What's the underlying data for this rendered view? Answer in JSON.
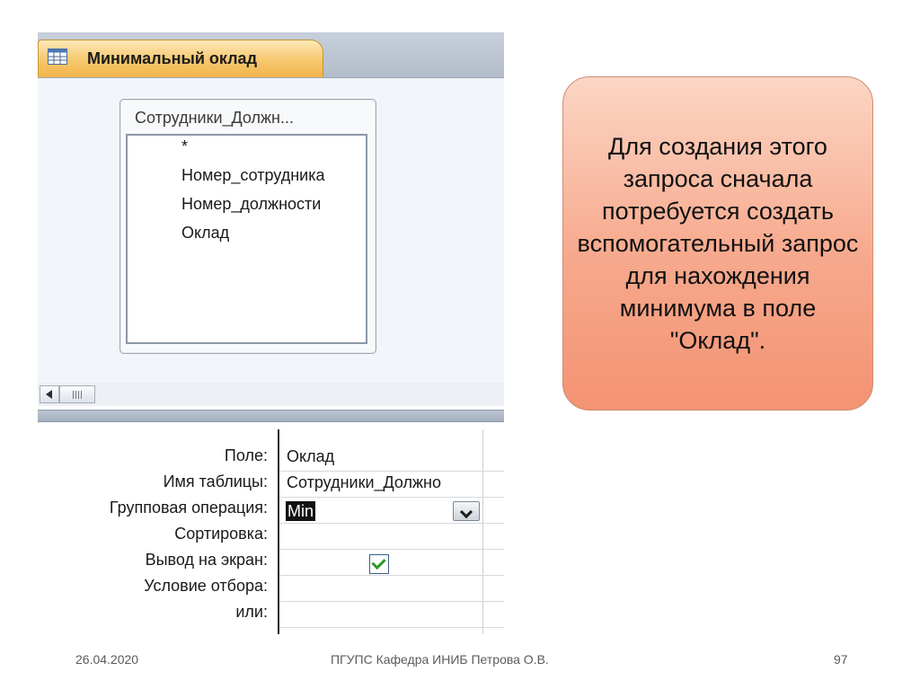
{
  "tab": {
    "title": "Минимальный оклад",
    "icon": "query-table-icon"
  },
  "field_list": {
    "title": "Сотрудники_Должн...",
    "fields": [
      "*",
      "Номер_сотрудника",
      "Номер_должности",
      "Оклад"
    ]
  },
  "grid": {
    "row_labels": [
      "Поле:",
      "Имя таблицы:",
      "Групповая операция:",
      "Сортировка:",
      "Вывод на экран:",
      "Условие отбора:",
      "или:"
    ],
    "field_value": "Оклад",
    "table_value": "Сотрудники_Должно",
    "group_operation": "Min",
    "show_checked": true
  },
  "callout": {
    "text": "Для создания этого запроса сначала потребуется создать вспомогательный запрос для нахождения минимума в поле \"Оклад\"."
  },
  "footer": {
    "date": "26.04.2020",
    "center": "ПГУПС  Кафедра  ИНИБ  Петрова О.В.",
    "page": "97"
  }
}
